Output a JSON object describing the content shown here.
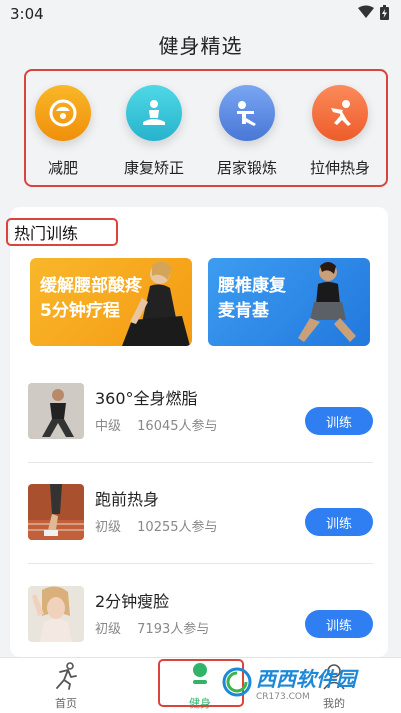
{
  "status_bar": {
    "time": "3:04",
    "wifi_icon": "wifi-icon",
    "battery_icon": "battery-icon"
  },
  "page": {
    "title": "健身精选"
  },
  "categories": [
    {
      "label": "减肥",
      "icon": "scale-icon",
      "color": "#f6a312"
    },
    {
      "label": "康复矫正",
      "icon": "meditation-icon",
      "color": "#37c6d8"
    },
    {
      "label": "居家锻炼",
      "icon": "exercise-icon",
      "color": "#5d8ee8"
    },
    {
      "label": "拉伸热身",
      "icon": "stretch-icon",
      "color": "#f3743f"
    }
  ],
  "section": {
    "title": "热门训练"
  },
  "banners": [
    {
      "text": "缓解腰部酸疼\n5分钟疗程",
      "color": "#f5a319"
    },
    {
      "text": "腰椎康复\n麦肯基",
      "color": "#2d8ae8"
    }
  ],
  "workouts": [
    {
      "name": "360°全身燃脂",
      "level": "中级",
      "participants": "16045人参与",
      "button": "训练"
    },
    {
      "name": "跑前热身",
      "level": "初级",
      "participants": "10255人参与",
      "button": "训练"
    },
    {
      "name": "2分钟瘦脸",
      "level": "初级",
      "participants": "7193人参与",
      "button": "训练"
    }
  ],
  "bottom_nav": [
    {
      "label": "首页",
      "icon": "running-icon"
    },
    {
      "label": "健身",
      "icon": "fitness-icon"
    },
    {
      "label": "我的",
      "icon": "user-icon"
    }
  ],
  "watermark": {
    "text": "西西软件园",
    "sub": "CR173.COM"
  },
  "colors": {
    "accent": "#2f7ff2",
    "highlight_border": "#d9453b",
    "active_tab": "#32b36a"
  }
}
